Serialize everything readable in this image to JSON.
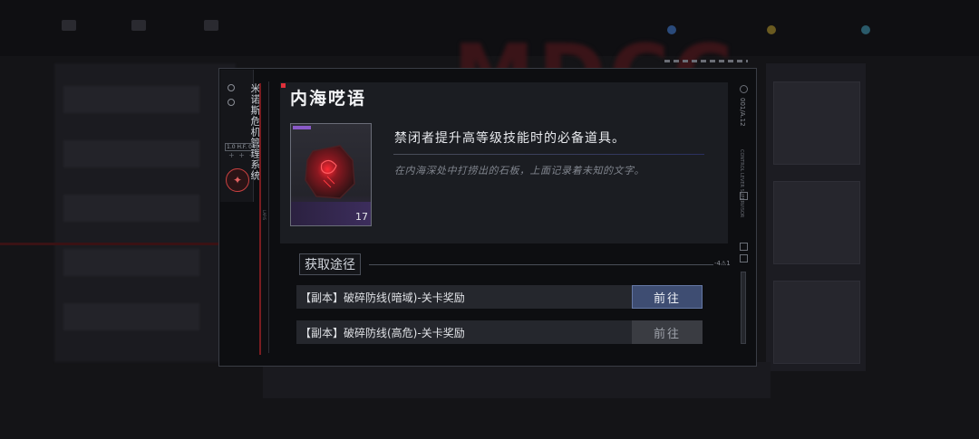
{
  "background": {
    "watermark_text": "MDCC"
  },
  "brand": {
    "title": "米诺斯危机管理系统",
    "version": "1.0 H.F. 04",
    "plus_marks": "+ + +"
  },
  "item": {
    "name": "内海呓语",
    "count": "17",
    "description": "禁闭者提升高等级技能时的必备道具。",
    "lore": "在内海深处中打捞出的石板，上面记录着未知的文字。",
    "icon": "stone-tablet-icon",
    "rarity_color": "#8a5ac8"
  },
  "acquisition": {
    "header": "获取途径",
    "tail_mark": "-4⚠1",
    "routes": [
      {
        "label": "【副本】破碎防线(暗域)-关卡奖励",
        "button": "前往",
        "state": "active"
      },
      {
        "label": "【副本】破碎防线(高危)-关卡奖励",
        "button": "前往",
        "state": "inactive"
      }
    ]
  },
  "side_text": {
    "right_code": "001/A.12",
    "right_small": "CONTROL LEVER SUPERVISOR",
    "left_small": "LAPIS"
  },
  "colors": {
    "accent_red": "#e0303a",
    "button_active": "#3e4d72",
    "button_inactive": "#3a3c42"
  }
}
